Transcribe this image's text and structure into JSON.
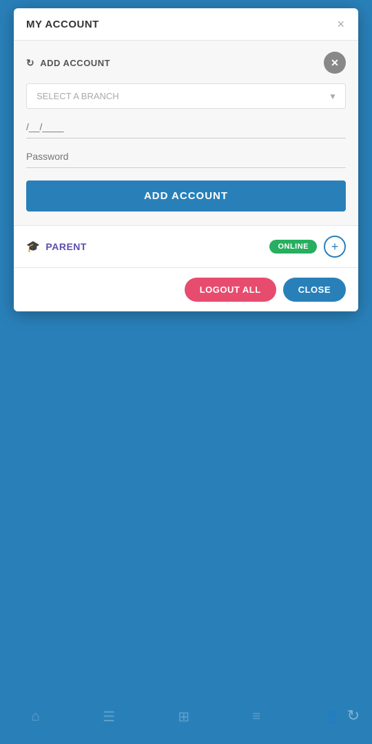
{
  "modal": {
    "title": "MY ACCOUNT",
    "close_x_label": "×"
  },
  "add_account_section": {
    "label": "ADD ACCOUNT",
    "refresh_icon": "↻",
    "close_circle_icon": "✕",
    "branch_select": {
      "placeholder": "SELECT A BRANCH",
      "options": [
        "SELECT A BRANCH"
      ]
    },
    "date_placeholder": "/__/____",
    "password_placeholder": "Password",
    "add_button_label": "ADD ACCOUNT"
  },
  "parent_section": {
    "graduation_icon": "🎓",
    "label": "PARENT",
    "online_badge": "ONLINE",
    "add_circle_icon": "+"
  },
  "footer": {
    "logout_all_label": "LOGOUT ALL",
    "close_label": "CLOSE"
  },
  "bottom": {
    "refresh_icon": "↻"
  }
}
